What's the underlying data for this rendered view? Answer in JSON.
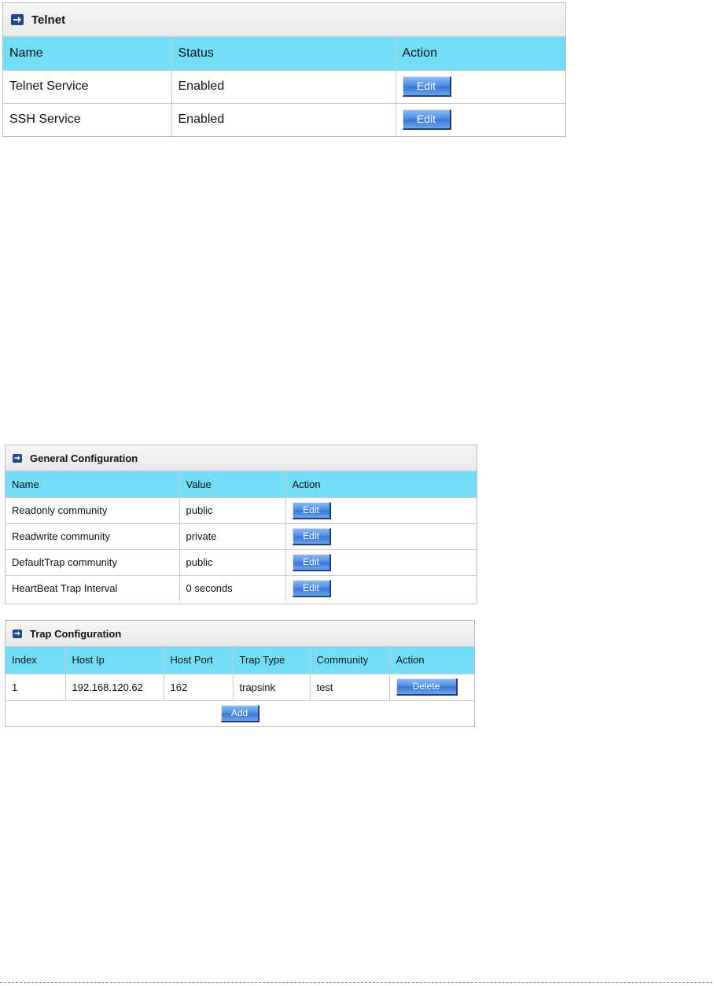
{
  "telnet": {
    "title": "Telnet",
    "columns": [
      "Name",
      "Status",
      "Action"
    ],
    "rows": [
      {
        "name": "Telnet Service",
        "status": "Enabled",
        "action": "Edit"
      },
      {
        "name": "SSH Service",
        "status": "Enabled",
        "action": "Edit"
      }
    ]
  },
  "general": {
    "title": "General Configuration",
    "columns": [
      "Name",
      "Value",
      "Action"
    ],
    "rows": [
      {
        "name": "Readonly community",
        "value": "public",
        "action": "Edit"
      },
      {
        "name": "Readwrite community",
        "value": "private",
        "action": "Edit"
      },
      {
        "name": "DefaultTrap community",
        "value": "public",
        "action": "Edit"
      },
      {
        "name": "HeartBeat Trap Interval",
        "value": "0 seconds",
        "action": "Edit"
      }
    ]
  },
  "trap": {
    "title": "Trap Configuration",
    "columns": [
      "Index",
      "Host Ip",
      "Host Port",
      "Trap Type",
      "Community",
      "Action"
    ],
    "rows": [
      {
        "index": "1",
        "host_ip": "192.168.120.62",
        "host_port": "162",
        "trap_type": "trapsink",
        "community": "test",
        "action": "Delete"
      }
    ],
    "add_label": "Add"
  },
  "icons": {
    "panel_header_icon": "arrow-right-icon",
    "icon_bg_color": "#1e4a86",
    "header_row_color": "#73ddf6",
    "button_color": "#4f8ee3"
  }
}
